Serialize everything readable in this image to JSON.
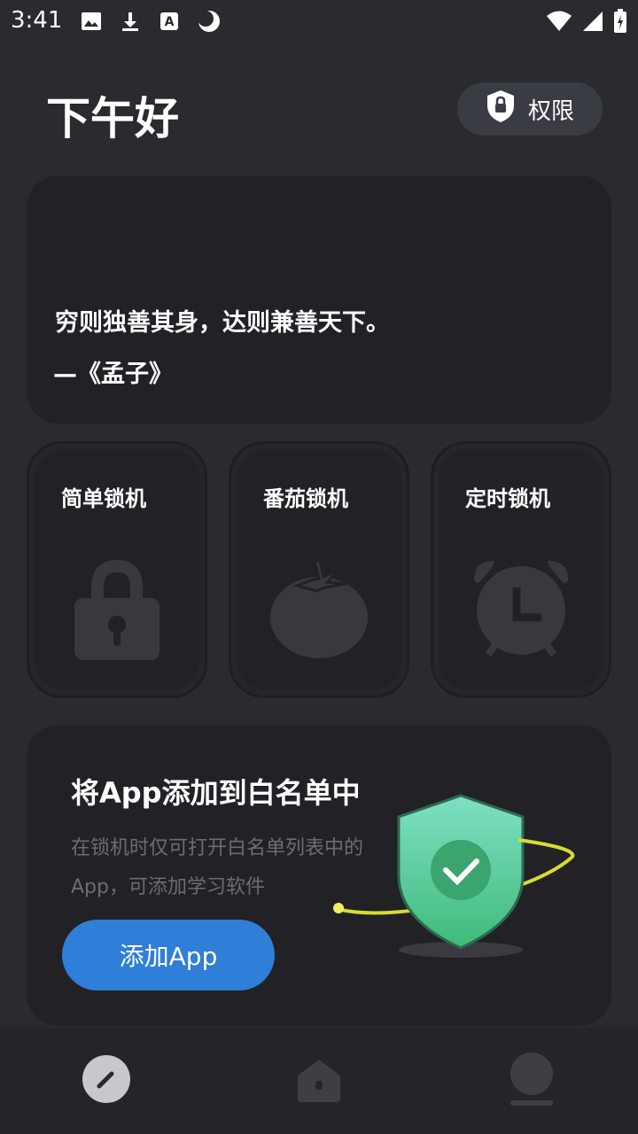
{
  "status_bar": {
    "time": "3:41",
    "left_icons": [
      "image-icon",
      "download-icon",
      "font-a-icon",
      "moon-icon"
    ],
    "right_icons": [
      "wifi-icon",
      "signal-icon",
      "battery-icon"
    ]
  },
  "header": {
    "greeting": "下午好",
    "permission_label": "权限"
  },
  "quote": {
    "text": "穷则独善其身，达则兼善天下。",
    "source": "—《孟子》"
  },
  "modes": [
    {
      "label": "简单锁机",
      "icon": "padlock-icon"
    },
    {
      "label": "番茄锁机",
      "icon": "tomato-icon"
    },
    {
      "label": "定时锁机",
      "icon": "alarm-clock-icon"
    }
  ],
  "whitelist": {
    "title": "将App添加到白名单中",
    "description": "在锁机时仅可打开白名单列表中的App，可添加学习软件",
    "button_label": "添加App",
    "art": "shield-check-icon"
  },
  "bottom_nav": [
    {
      "icon": "pencil-icon",
      "active": true
    },
    {
      "icon": "home-icon",
      "active": false
    },
    {
      "icon": "user-icon",
      "active": false
    }
  ],
  "colors": {
    "background": "#2a2a2f",
    "card": "#212126",
    "accent_blue": "#2f7ed8",
    "shield_green": "#4fd39a",
    "text_muted": "#6c6c73"
  }
}
